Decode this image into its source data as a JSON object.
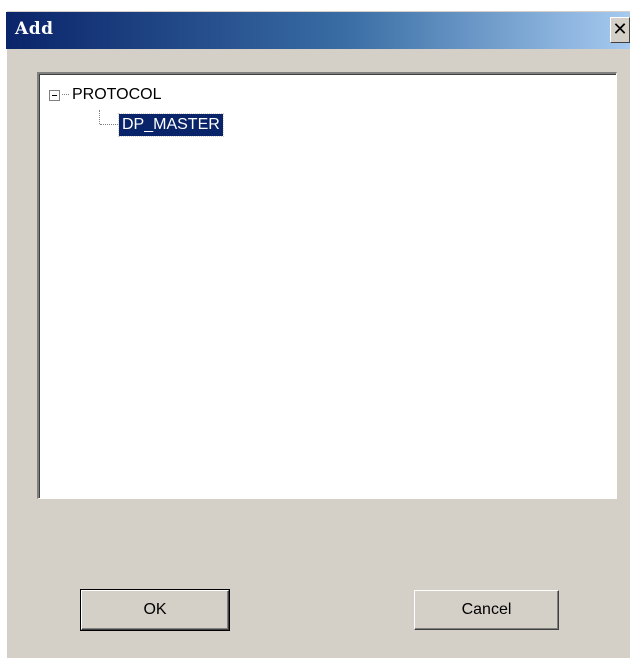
{
  "window": {
    "title": "Add",
    "close_glyph": "✕"
  },
  "tree": {
    "root": {
      "label": "PROTOCOL",
      "expanded": true,
      "expander_glyph": "minus-box-icon"
    },
    "children": [
      {
        "label": "DP_MASTER",
        "selected": true
      }
    ]
  },
  "buttons": {
    "ok_label": "OK",
    "cancel_label": "Cancel"
  },
  "colors": {
    "title_gradient_start": "#0a246a",
    "title_gradient_end": "#a6caf0",
    "selection_bg": "#0a246a",
    "dialog_bg": "#d4d0c8"
  }
}
